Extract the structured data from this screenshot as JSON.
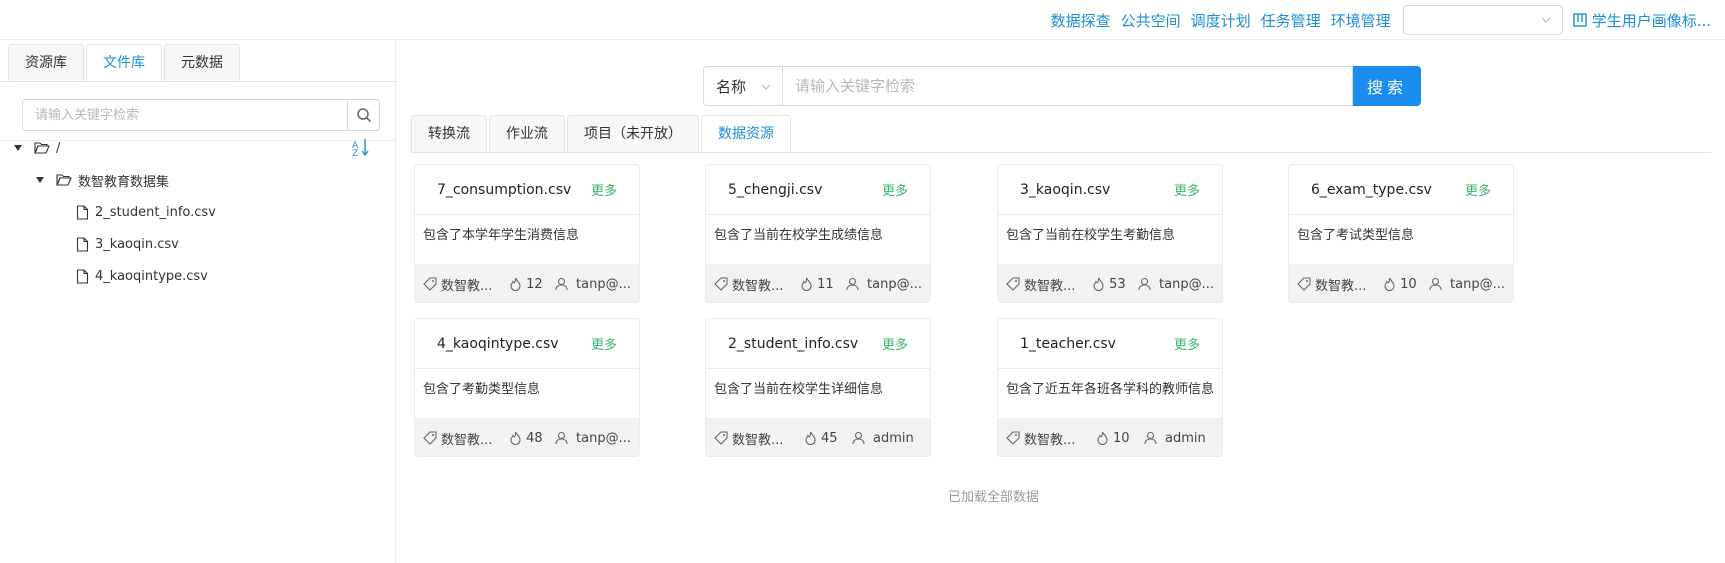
{
  "topnav": {
    "links": [
      "数据探查",
      "公共空间",
      "调度计划",
      "任务管理",
      "环境管理"
    ],
    "env_select_value": "",
    "profile_label": "学生用户画像标..."
  },
  "left_panel": {
    "tabs": [
      "资源库",
      "文件库",
      "元数据"
    ],
    "active_tab": "文件库",
    "search_placeholder": "请输入关键字检索",
    "tree": {
      "root": "/",
      "folder": "数智教育数据集",
      "files": [
        "2_student_info.csv",
        "3_kaoqin.csv",
        "4_kaoqintype.csv"
      ]
    }
  },
  "main": {
    "search": {
      "field": "名称",
      "placeholder": "请输入关键字检索",
      "button_label": "搜索"
    },
    "tabs": [
      "转换流",
      "作业流",
      "项目（未开放）",
      "数据资源"
    ],
    "active_tab": "数据资源",
    "more_label": "更多",
    "cards": [
      {
        "name": "7_consumption.csv",
        "desc": "包含了本学年学生消费信息",
        "tag": "数智教...",
        "likes": "12",
        "owner": "tanp@..."
      },
      {
        "name": "5_chengji.csv",
        "desc": "包含了当前在校学生成绩信息",
        "tag": "数智教...",
        "likes": "11",
        "owner": "tanp@..."
      },
      {
        "name": "3_kaoqin.csv",
        "desc": "包含了当前在校学生考勤信息",
        "tag": "数智教...",
        "likes": "53",
        "owner": "tanp@..."
      },
      {
        "name": "6_exam_type.csv",
        "desc": "包含了考试类型信息",
        "tag": "数智教...",
        "likes": "10",
        "owner": "tanp@..."
      },
      {
        "name": "4_kaoqintype.csv",
        "desc": "包含了考勤类型信息",
        "tag": "数智教...",
        "likes": "48",
        "owner": "tanp@..."
      },
      {
        "name": "2_student_info.csv",
        "desc": "包含了当前在校学生详细信息",
        "tag": "数智教...",
        "likes": "45",
        "owner": "admin"
      },
      {
        "name": "1_teacher.csv",
        "desc": "包含了近五年各班各学科的教师信息",
        "tag": "数智教...",
        "likes": "10",
        "owner": "admin"
      }
    ],
    "footer_text": "已加载全部数据"
  },
  "colors": {
    "link": "#1a8fd8",
    "primary_button": "#1a8cf0",
    "more": "#3cb371",
    "card_footer_bg": "#f2f2f5"
  }
}
